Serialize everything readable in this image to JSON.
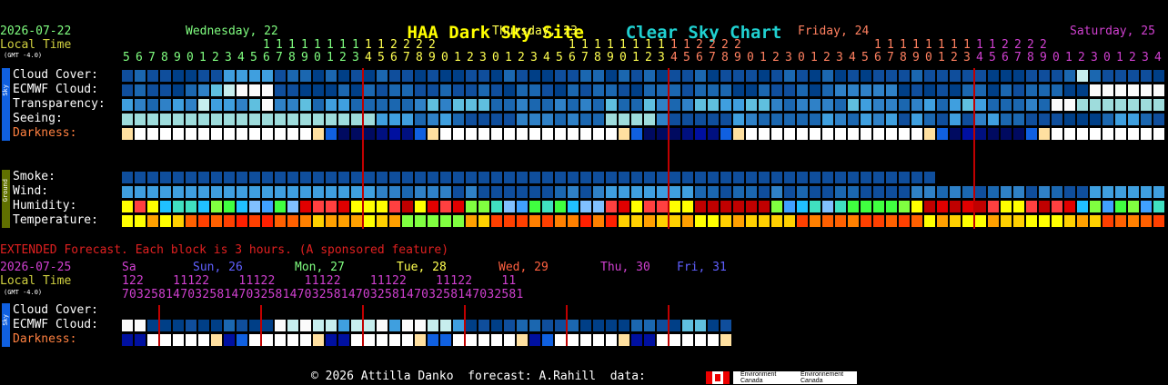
{
  "title": {
    "site": "HAA Dark Sky Site",
    "chart": "Clear Sky Chart"
  },
  "main": {
    "date_label": "2026-07-22",
    "local_time_label": "Local Time",
    "gmt_label": "(GMT -4.0)",
    "days": [
      {
        "label": "Wednesday, 22",
        "color": "#80ff80"
      },
      {
        "label": "Thursday, 23",
        "color": "#ffff50"
      },
      {
        "label": "Friday, 24",
        "color": "#ff8060"
      },
      {
        "label": "Saturday, 25",
        "color": "#d040d0"
      }
    ],
    "hours_tens_row1": "           11111111112222          11111111112222          11111111112222          11111",
    "hours_row": "56789012345678901234567890123012345678901234567890123012345678901234567890123012345678901234",
    "rows": [
      "Cloud Cover:",
      "ECMWF Cloud:",
      "Transparency:",
      "Seeing:",
      "Darkness:",
      "Smoke:",
      "Wind:",
      "Humidity:",
      "Temperature:"
    ],
    "sky_tag": "Sky",
    "ground_tag": "Ground"
  },
  "extended": {
    "heading": "EXTENDED Forecast. Each block is 3 hours. (A sponsored feature)",
    "date_label": "2026-07-25",
    "local_time_label": "Local Time",
    "gmt_label": "(GMT -4.0)",
    "days": [
      {
        "label": "Sa",
        "color": "#d040d0"
      },
      {
        "label": "Sun, 26",
        "color": "#6060ff"
      },
      {
        "label": "Mon, 27",
        "color": "#80ff80"
      },
      {
        "label": "Tue, 28",
        "color": "#ffff50"
      },
      {
        "label": "Wed, 29",
        "color": "#ff6040"
      },
      {
        "label": "Thu, 30",
        "color": "#d040d0"
      },
      {
        "label": "Fri, 31",
        "color": "#6060ff"
      }
    ],
    "hours_row1": "122    11122    11122    11122    11122    11122    11",
    "hours_row2": "7032581470325814703258147032581470325814703258147032581",
    "rows": [
      "Cloud Cover:",
      "ECMWF Cloud:",
      "Darkness:"
    ],
    "sky_tag": "Sky"
  },
  "footer": {
    "text": "© 2026 Attilla Danko  forecast: A.Rahill  data:",
    "logo1": "Environment Canada",
    "logo2": "Environnement Canada"
  },
  "colors": {
    "cloud": [
      "#fbfbfb",
      "#c7eeee",
      "#9edcdc",
      "#5fbfdf",
      "#3f9fdf",
      "#2f81c7",
      "#1b67b0",
      "#0f4e9c",
      "#003f87"
    ],
    "darkness_day": "#ffffff",
    "darkness_dark": "#000a50",
    "seeing_good": "#1b67b0",
    "red_line": "#c00000",
    "sky_tag": "#1060e0",
    "ground_tag": "#607000"
  }
}
